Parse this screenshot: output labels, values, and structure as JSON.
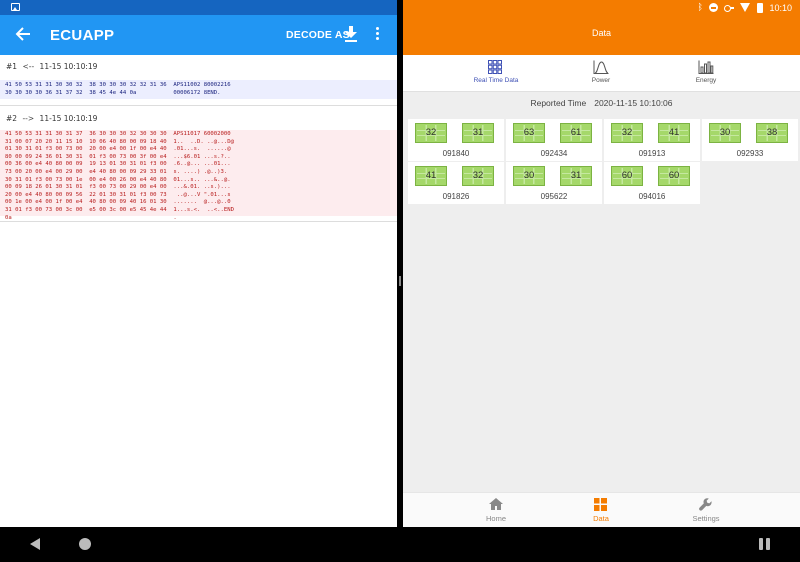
{
  "left": {
    "toolbar": {
      "title": "ECUAPP",
      "decode_label": "DECODE AS",
      "download_icon": "download-icon",
      "more_icon": "more-vert-icon",
      "back_icon": "arrow-back-icon"
    },
    "messages": [
      {
        "index": "#1",
        "direction": "<--",
        "time": "11-15 10:10:19",
        "hex": "41 50 53 31 31 30 30 32  38 30 30 30 32 32 31 36  APS11002 80002216\n30 30 30 30 36 31 37 32  38 45 4e 44 0a           00006172 8END."
      },
      {
        "index": "#2",
        "direction": "-->",
        "time": "11-15 10:10:19",
        "hex": "41 50 53 31 31 30 31 37  36 30 30 30 32 30 30 30  APS11017 60002000\n31 00 07 20 20 11 15 10  10 06 40 80 00 09 18 40  1..  ..D. ..@...D@\n01 30 31 01 f3 00 73 00  20 00 e4 00 1f 00 e4 40  .01...s.  ......@\n80 00 09 24 36 01 30 31  01 f3 00 73 00 3f 00 e4  ...$6.01 ...s.?..\n00 36 00 e4 40 80 00 09  19 13 01 30 31 01 f3 00  .6..@... ...01...\n73 00 20 00 e4 00 29 00  e4 40 80 00 09 29 33 01  s. ....) .@..)3.\n30 31 01 f3 00 73 00 1e  00 e4 00 26 00 e4 40 80  01...s.. ...&..@.\n00 09 18 26 01 30 31 01  f3 00 73 00 29 00 e4 00  ...&.01. ..s.)...\n20 00 e4 40 80 00 09 56  22 01 30 31 01 f3 00 73   ..@...V \".01...s\n00 1e 00 e4 00 1f 00 e4  40 80 00 09 40 16 01 30  .......  @...@..0\n31 01 f3 00 73 00 3c 00  e5 00 3c 00 e5 45 4e 44  1...s.<.  ..<..END\n0a                                                ."
      }
    ]
  },
  "right": {
    "status_bar": {
      "time": "10:10",
      "icons": [
        "bluetooth-icon",
        "do-not-disturb-icon",
        "vpn-key-icon",
        "wifi-icon",
        "battery-icon"
      ]
    },
    "app_bar_title": "Data",
    "tabs": [
      {
        "label": "Real Time Data",
        "icon": "grid-icon",
        "active": true
      },
      {
        "label": "Power",
        "icon": "power-curve-icon",
        "active": false
      },
      {
        "label": "Energy",
        "icon": "bar-chart-icon",
        "active": false
      }
    ],
    "reported_label": "Reported Time",
    "reported_value": "2020-11-15 10:10:06",
    "inverters": [
      {
        "id": "091840",
        "panels": [
          "32",
          "31"
        ]
      },
      {
        "id": "092434",
        "panels": [
          "63",
          "61"
        ]
      },
      {
        "id": "091913",
        "panels": [
          "32",
          "41"
        ]
      },
      {
        "id": "092933",
        "panels": [
          "30",
          "38"
        ]
      },
      {
        "id": "091826",
        "panels": [
          "41",
          "32"
        ]
      },
      {
        "id": "095622",
        "panels": [
          "30",
          "31"
        ]
      },
      {
        "id": "094016",
        "panels": [
          "60",
          "60"
        ]
      }
    ],
    "bottom_nav": [
      {
        "label": "Home",
        "icon": "home-icon",
        "active": false
      },
      {
        "label": "Data",
        "icon": "data-grid-icon",
        "active": true
      },
      {
        "label": "Settings",
        "icon": "wrench-icon",
        "active": false
      }
    ],
    "colors": {
      "accent": "#f47c00",
      "panel_green": "#a5d86a",
      "tab_active": "#3f51b5"
    }
  },
  "system_nav": {
    "back_icon": "nav-back-icon",
    "home_icon": "nav-home-icon",
    "split_icon": "split-screen-icon"
  }
}
